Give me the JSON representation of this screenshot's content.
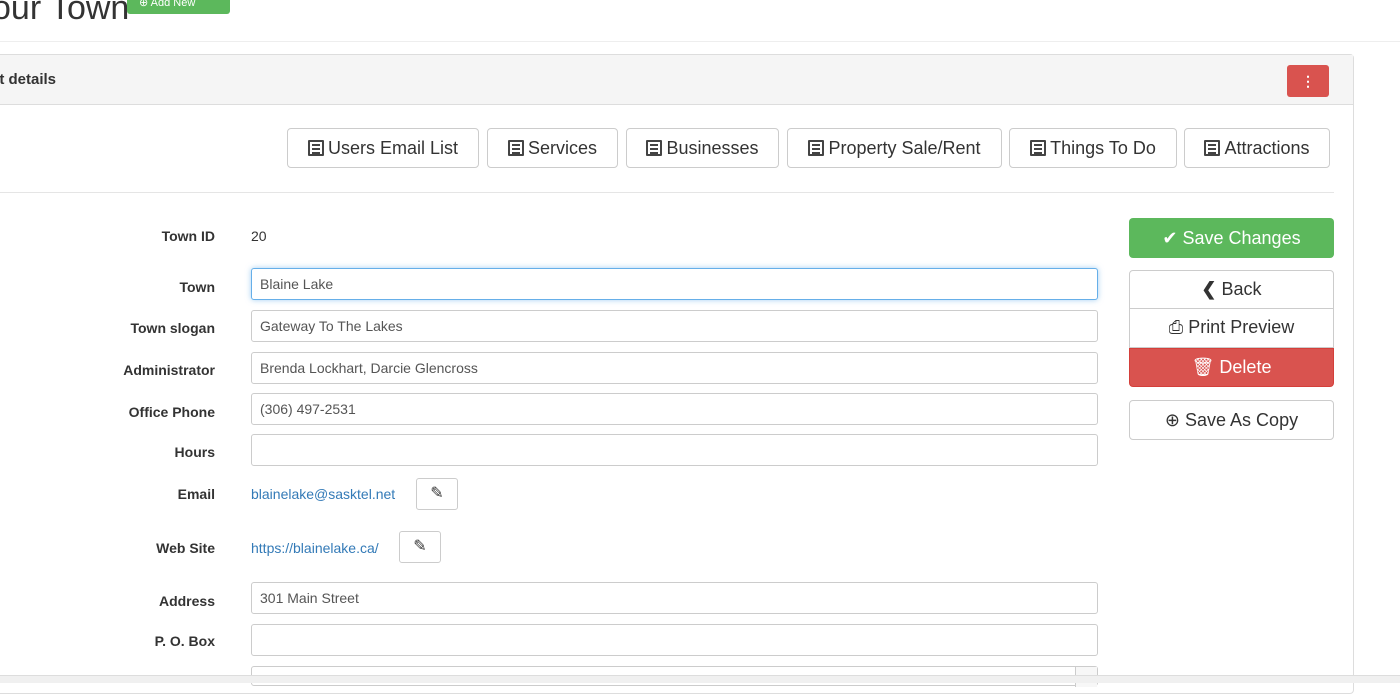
{
  "header": {
    "title": "our Town",
    "add_new_label": "Add New",
    "add_new_icon": "plus-circle-icon"
  },
  "panel": {
    "title": "ct details",
    "menu_icon": "vertical-ellipsis-icon"
  },
  "nav_buttons": [
    {
      "label": "Users Email List",
      "icon": "list-icon"
    },
    {
      "label": "Services",
      "icon": "list-icon"
    },
    {
      "label": "Businesses",
      "icon": "list-icon"
    },
    {
      "label": "Property Sale/Rent",
      "icon": "list-icon"
    },
    {
      "label": "Things To Do",
      "icon": "list-icon"
    },
    {
      "label": "Attractions",
      "icon": "list-icon"
    }
  ],
  "form": {
    "town_id": {
      "label": "Town ID",
      "value": "20"
    },
    "town": {
      "label": "Town",
      "value": "Blaine Lake"
    },
    "slogan": {
      "label": "Town slogan",
      "value": "Gateway To The Lakes"
    },
    "administrator": {
      "label": "Administrator",
      "value": "Brenda Lockhart,  Darcie Glencross"
    },
    "office_phone": {
      "label": "Office Phone",
      "value": "(306) 497-2531"
    },
    "hours": {
      "label": "Hours",
      "value": ""
    },
    "email": {
      "label": "Email",
      "value": "blainelake@sasktel.net"
    },
    "website": {
      "label": "Web Site",
      "value": "https://blainelake.ca/"
    },
    "address": {
      "label": "Address",
      "value": "301 Main Street"
    },
    "po_box": {
      "label": "P. O. Box",
      "value": ""
    }
  },
  "actions": {
    "save_changes": "Save Changes",
    "back": "Back",
    "print_preview": "Print Preview",
    "delete": "Delete",
    "save_as_copy": "Save As Copy"
  },
  "colors": {
    "success": "#5cb85c",
    "danger": "#d9534f",
    "link": "#337ab7",
    "focus": "#66afe9"
  }
}
